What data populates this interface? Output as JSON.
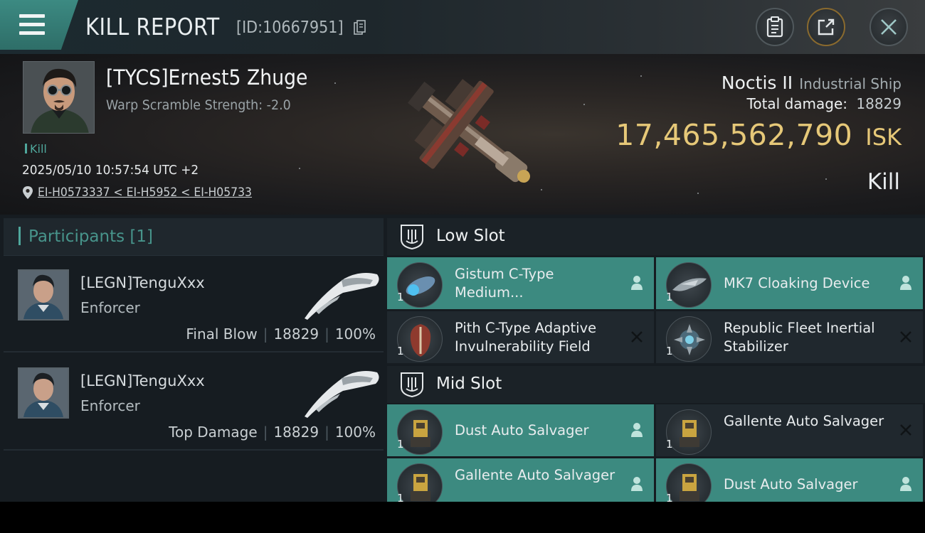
{
  "header": {
    "title": "KILL REPORT",
    "report_id": "[ID:10667951]",
    "icons": [
      "menu-icon",
      "copy-icon",
      "clipboard-icon",
      "share-icon",
      "close-icon"
    ]
  },
  "victim": {
    "name": "[TYCS]Ernest5 Zhuge",
    "warp_scramble": "Warp Scramble Strength: -2.0",
    "tag": "Kill",
    "timestamp": "2025/05/10 10:57:54 UTC +2",
    "location": "EI-H0573337 < EI-H5952 < EI-H05733",
    "ship_name": "Noctis II",
    "ship_class": "Industrial Ship",
    "total_damage_label": "Total damage:",
    "total_damage": "18829",
    "isk_value": "17,465,562,790",
    "isk_unit": "ISK",
    "result": "Kill"
  },
  "participants": {
    "title": "Participants [1]",
    "rows": [
      {
        "name": "[LEGN]TenguXxx",
        "ship": "Enforcer",
        "role": "Final Blow",
        "damage": "18829",
        "percent": "100%"
      },
      {
        "name": "[LEGN]TenguXxx",
        "ship": "Enforcer",
        "role": "Top Damage",
        "damage": "18829",
        "percent": "100%"
      }
    ]
  },
  "fitting": {
    "low_slot": {
      "title": "Low Slot",
      "modules": [
        {
          "name": "Gistum C-Type Medium...",
          "qty": "1",
          "status": "dropped"
        },
        {
          "name": "MK7 Cloaking Device",
          "qty": "1",
          "status": "dropped"
        },
        {
          "name": "Pith C-Type Adaptive Invulnerability Field",
          "qty": "1",
          "status": "destroyed"
        },
        {
          "name": "Republic Fleet Inertial Stabilizer",
          "qty": "1",
          "status": "destroyed"
        }
      ]
    },
    "mid_slot": {
      "title": "Mid Slot",
      "modules": [
        {
          "name": "Dust Auto Salvager",
          "qty": "1",
          "status": "dropped"
        },
        {
          "name": "Gallente Auto Salvager",
          "qty": "1",
          "status": "destroyed"
        },
        {
          "name": "Gallente Auto Salvager",
          "qty": "1",
          "status": "dropped"
        },
        {
          "name": "Dust Auto Salvager",
          "qty": "1",
          "status": "dropped"
        }
      ]
    }
  },
  "colors": {
    "accent_teal": "#3c8a80",
    "isk_gold": "#e6c878",
    "panel_dark": "#161c21"
  }
}
